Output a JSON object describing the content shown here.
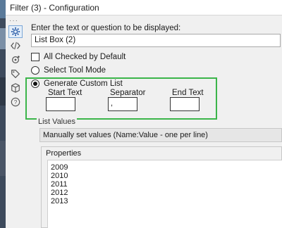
{
  "window": {
    "title": "Filter (3) - Configuration"
  },
  "rail": {
    "dots": "···"
  },
  "config": {
    "prompt_label": "Enter the text or question to be displayed:",
    "prompt_value": "List Box (2)",
    "all_checked_label": "All Checked by Default",
    "select_tool_mode_label": "Select Tool Mode",
    "generate_custom_list_label": "Generate Custom List",
    "start_text_label": "Start Text",
    "separator_label": "Separator",
    "end_text_label": "End Text",
    "start_text_value": "",
    "separator_value": ",",
    "end_text_value": "",
    "list_values_label": "List Values",
    "list_values_selected": "Manually set values (Name:Value - one per line)",
    "properties_label": "Properties",
    "properties_lines": [
      "2009",
      "2010",
      "2011",
      "2012",
      "2013"
    ]
  },
  "colors": {
    "highlight_border": "#3bb54a",
    "left_strip": "#3d4a5c"
  }
}
